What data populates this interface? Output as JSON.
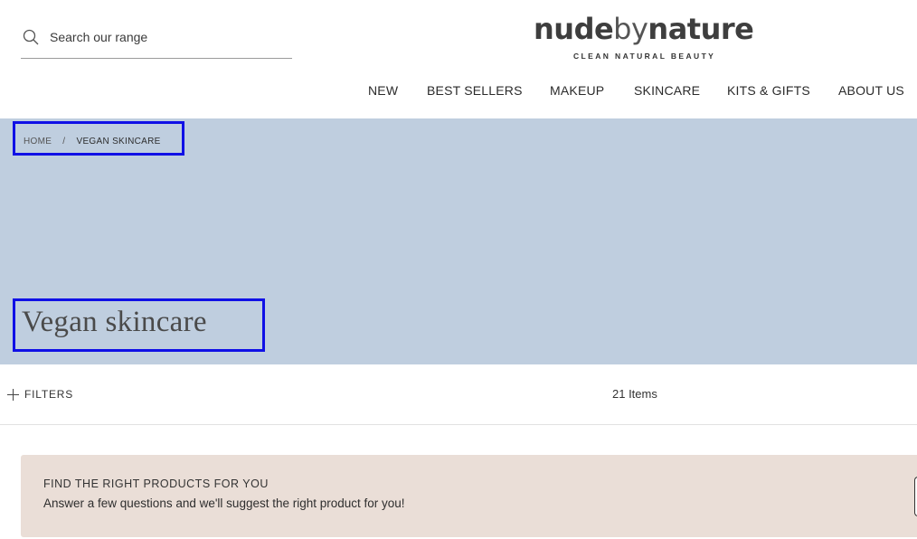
{
  "header": {
    "search": {
      "placeholder": "Search our range"
    },
    "logo": {
      "part1": "nude",
      "part2": "by",
      "part3": "nature",
      "tagline": "CLEAN NATURAL BEAUTY"
    },
    "nav": [
      {
        "label": "NEW"
      },
      {
        "label": "BEST SELLERS"
      },
      {
        "label": "MAKEUP"
      },
      {
        "label": "SKINCARE"
      },
      {
        "label": "KITS & GIFTS"
      },
      {
        "label": "ABOUT US"
      }
    ]
  },
  "hero": {
    "breadcrumb": {
      "home": "HOME",
      "separator": "/",
      "current": "VEGAN SKINCARE"
    },
    "title": "Vegan skincare",
    "background_color": "#bfcedf"
  },
  "toolbar": {
    "filters_label": "FILTERS",
    "item_count": "21 Items"
  },
  "quiz_banner": {
    "title": "FIND THE RIGHT PRODUCTS FOR YOU",
    "text": "Answer a few questions and we'll suggest the right product for you!",
    "background_color": "#eaded7"
  },
  "icons": {
    "search": "search-icon",
    "filters": "plus-icon"
  },
  "highlight_color": "#1010e6"
}
